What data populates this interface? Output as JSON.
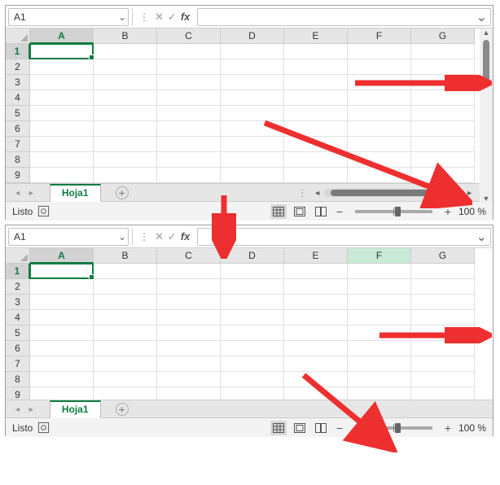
{
  "colors": {
    "accent": "#107c41",
    "arrow": "#ed2f2f"
  },
  "top": {
    "namebox": "A1",
    "formula": "",
    "columns": [
      "A",
      "B",
      "C",
      "D",
      "E",
      "F",
      "G"
    ],
    "activeCol": "A",
    "rows": [
      "1",
      "2",
      "3",
      "4",
      "5",
      "6",
      "7",
      "8",
      "9"
    ],
    "activeRow": "1",
    "sheet_tab": "Hoja1",
    "status": "Listo",
    "zoom": "100 %",
    "show_scrollbars": true
  },
  "bottom": {
    "namebox": "A1",
    "formula": "",
    "columns": [
      "A",
      "B",
      "C",
      "D",
      "E",
      "F",
      "G"
    ],
    "activeCol": "A",
    "altActiveCol": "F",
    "rows": [
      "1",
      "2",
      "3",
      "4",
      "5",
      "6",
      "7",
      "8",
      "9"
    ],
    "activeRow": "1",
    "sheet_tab": "Hoja1",
    "status": "Listo",
    "zoom": "100 %",
    "show_scrollbars": false
  },
  "icons": {
    "cancel": "✕",
    "accept": "✓",
    "fx": "fx",
    "chevron": "⌄",
    "leftarr": "◄",
    "rightarr": "►",
    "uparr": "▲",
    "downarr": "▼",
    "plus": "+",
    "minus": "−",
    "vdots": "⋮"
  }
}
